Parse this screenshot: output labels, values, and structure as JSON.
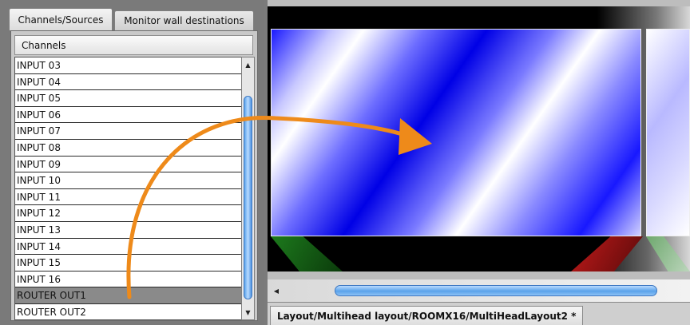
{
  "left_panel": {
    "tabs": [
      {
        "label": "Channels/Sources",
        "active": true
      },
      {
        "label": "Monitor wall destinations",
        "active": false
      }
    ],
    "list": {
      "header": "Channels",
      "items": [
        "INPUT 03",
        "INPUT 04",
        "INPUT 05",
        "INPUT 06",
        "INPUT 07",
        "INPUT 08",
        "INPUT 09",
        "INPUT 10",
        "INPUT 11",
        "INPUT 12",
        "INPUT 13",
        "INPUT 14",
        "INPUT 15",
        "INPUT 16",
        "ROUTER OUT1",
        "ROUTER OUT2"
      ],
      "selected": "ROUTER OUT1"
    }
  },
  "right_panel": {
    "document_tab": "Layout/Multihead layout/ROOMX16/MultiHeadLayout2 *"
  },
  "colors": {
    "drag_arrow": "#ee8a1a",
    "scroll_thumb": "#5aa2ea",
    "monitor_blue": "#0000e6"
  },
  "icons": {
    "scroll_up": "up-arrow",
    "scroll_down": "down-arrow",
    "scroll_left": "left-arrow",
    "drag_indicator": "curved-arrow"
  }
}
